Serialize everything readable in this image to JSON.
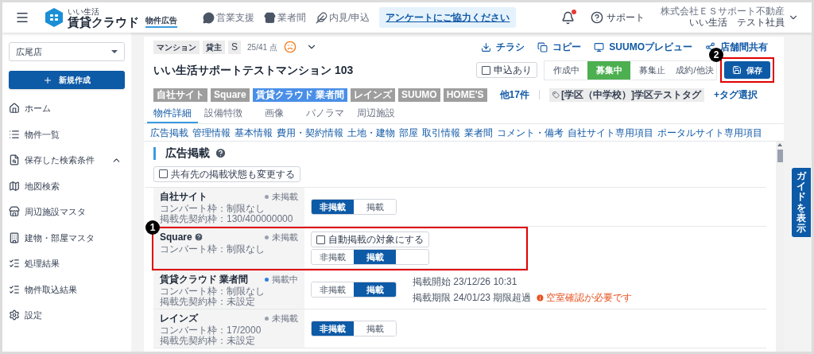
{
  "header": {
    "app_small": "いい生活",
    "app_name": "賃貸クラウド",
    "module": "物件広告",
    "nav": [
      {
        "kind": "chat",
        "label": "営業支援"
      },
      {
        "kind": "store",
        "label": "業者間"
      },
      {
        "kind": "pen",
        "label": "内見/申込"
      }
    ],
    "survey_link": "アンケートにご協力ください",
    "notification_unread": true,
    "support": "サポート",
    "company": "株式会社ＥＳサポート不動産",
    "user": "いい生活　テスト社員"
  },
  "sidebar": {
    "store": "広尾店",
    "new_button": "新規作成",
    "items": [
      {
        "kind": "home",
        "label": "ホーム"
      },
      {
        "kind": "list",
        "label": "物件一覧"
      },
      {
        "kind": "saved",
        "label": "保存した検索条件",
        "expanded": true
      },
      {
        "kind": "map",
        "label": "地図検索"
      },
      {
        "kind": "store",
        "label": "周辺施設マスタ"
      },
      {
        "kind": "building",
        "label": "建物・部屋マスタ"
      },
      {
        "kind": "checklist",
        "label": "処理結果"
      },
      {
        "kind": "checklist",
        "label": "物件取込結果"
      },
      {
        "kind": "settings",
        "label": "設定"
      }
    ]
  },
  "property": {
    "badges": [
      "マンション",
      "貸主",
      "S"
    ],
    "score": "25/41 点",
    "actions": [
      {
        "kind": "download",
        "label": "チラシ"
      },
      {
        "kind": "copy",
        "label": "コピー"
      },
      {
        "kind": "monitor",
        "label": "SUUMOプレビュー"
      },
      {
        "kind": "share",
        "label": "店舗間共有"
      }
    ],
    "title": "いい生活サポートテストマンション 103",
    "application": {
      "label": "申込あり",
      "checked": false
    },
    "statuses": [
      {
        "label": "作成中",
        "selected": false
      },
      {
        "label": "募集中",
        "selected": true
      },
      {
        "label": "募集止",
        "selected": false
      },
      {
        "label": "成約/他決",
        "selected": false
      }
    ],
    "save_button": "保存",
    "portal_tags": [
      {
        "label": "自社サイト",
        "color": "#9e9e9e"
      },
      {
        "label": "Square",
        "color": "#9e9e9e"
      },
      {
        "label": "賃貸クラウド 業者間",
        "color": "#4a8fe7"
      },
      {
        "label": "レインズ",
        "color": "#9e9e9e"
      },
      {
        "label": "SUUMO",
        "color": "#9e9e9e"
      },
      {
        "label": "HOME'S",
        "color": "#9e9e9e"
      }
    ],
    "more_portals": "他17件",
    "tags": [
      "[学区（中学校）]学区テストタグ"
    ],
    "tag_select": "+タグ選択",
    "tabs": [
      {
        "label": "物件詳細",
        "selected": true
      },
      {
        "label": "設備特徴",
        "selected": false
      },
      {
        "label": "画像",
        "selected": false
      },
      {
        "label": "パノラマ",
        "selected": false
      },
      {
        "label": "周辺施設",
        "selected": false
      }
    ],
    "section_links": [
      "広告掲載",
      "管理情報",
      "基本情報",
      "費用・契約情報",
      "土地・建物",
      "部屋",
      "取引情報",
      "業者間",
      "コメント・備考",
      "自社サイト専用項目",
      "ポータルサイト専用項目"
    ]
  },
  "ad_section": {
    "title": "広告掲載",
    "share_checkbox": {
      "label": "共有先の掲載状態も変更する",
      "checked": false
    },
    "sites": [
      {
        "name": "自社サイト",
        "help": false,
        "status": "未掲載",
        "published": false,
        "lines": [
          "コンバート枠：制限なし",
          "掲載先契約枠：130/400000000"
        ],
        "options": [
          {
            "label": "非掲載",
            "selected": true
          },
          {
            "label": "掲載",
            "selected": false
          }
        ]
      },
      {
        "name": "Square",
        "help": true,
        "status": "未掲載",
        "published": false,
        "lines": [
          "コンバート枠：制限なし"
        ],
        "auto_publish": {
          "label": "自動掲載の対象にする",
          "checked": false
        },
        "options": [
          {
            "label": "非掲載",
            "selected": false
          },
          {
            "label": "掲載",
            "selected": true
          }
        ]
      },
      {
        "name": "賃貸クラウド 業者間",
        "help": false,
        "status": "掲載中",
        "published": true,
        "lines": [
          "コンバート枠：制限なし",
          "掲載先契約枠：未設定"
        ],
        "options": [
          {
            "label": "非掲載",
            "selected": false
          },
          {
            "label": "掲載",
            "selected": true
          }
        ],
        "info": [
          "掲載開始 23/12/26 10:31",
          "掲載期限 24/01/23 期限超過"
        ],
        "warning": "空室確認が必要です"
      },
      {
        "name": "レインズ",
        "help": false,
        "status": "未掲載",
        "published": false,
        "lines": [
          "コンバート枠：17/2000",
          "掲載先契約枠：未設定"
        ],
        "options": [
          {
            "label": "非掲載",
            "selected": true
          },
          {
            "label": "掲載",
            "selected": false
          }
        ]
      }
    ]
  },
  "guide_tab": "ガイドを表示",
  "markers": [
    "1",
    "2"
  ]
}
